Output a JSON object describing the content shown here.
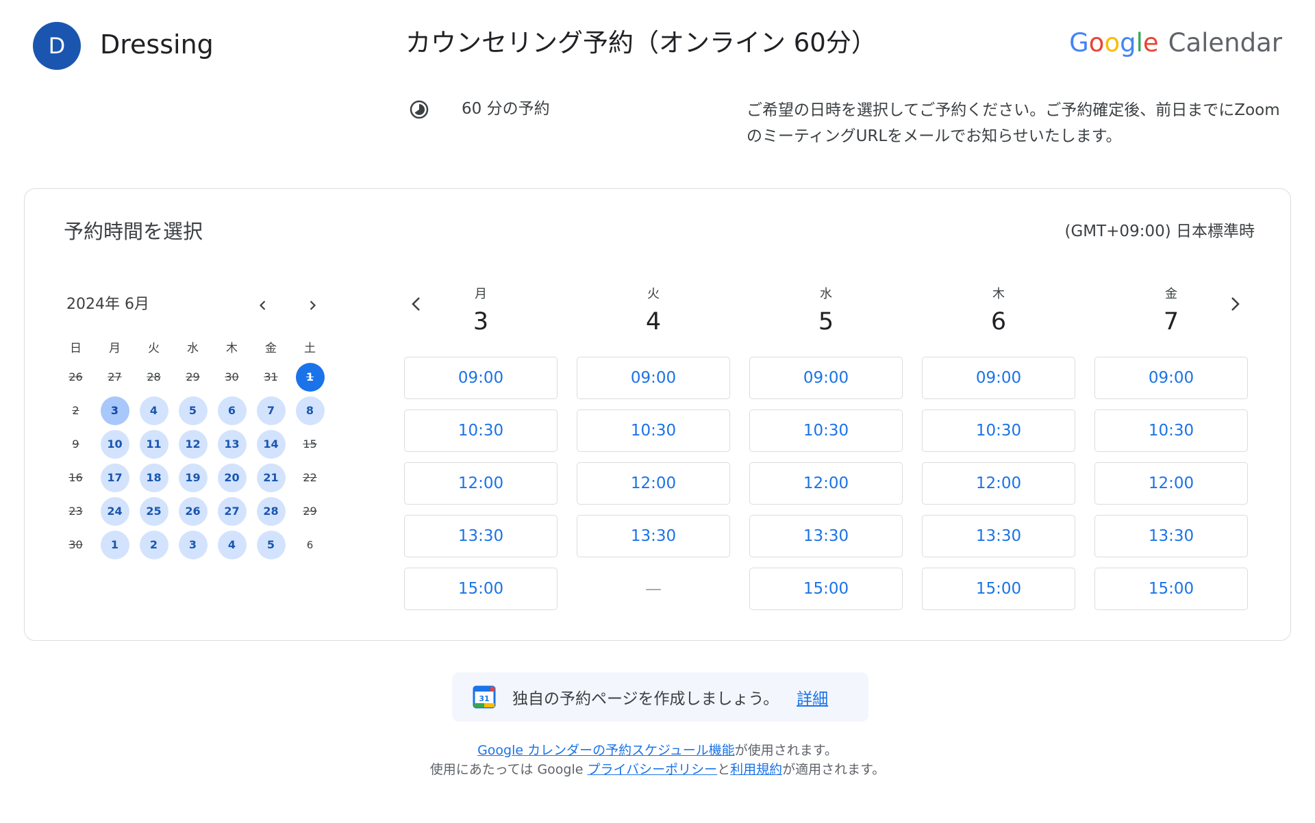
{
  "header": {
    "avatar_letter": "D",
    "org_name": "Dressing",
    "page_title": "カウンセリング予約（オンライン 60分）",
    "logo": {
      "g1": "G",
      "g2": "o",
      "g3": "o",
      "g4": "g",
      "g5": "l",
      "g6": "e",
      "product": "Calendar"
    },
    "duration": "60 分の予約",
    "description": "ご希望の日時を選択してご予約ください。ご予約確定後、前日までにZoomのミーティングURLをメールでお知らせいたします。"
  },
  "card": {
    "title": "予約時間を選択",
    "timezone": "(GMT+09:00) 日本標準時"
  },
  "mini_calendar": {
    "month_label": "2024年 6月",
    "weekdays": [
      "日",
      "月",
      "火",
      "水",
      "木",
      "金",
      "土"
    ],
    "weeks": [
      [
        {
          "d": "26",
          "s": "past"
        },
        {
          "d": "27",
          "s": "past"
        },
        {
          "d": "28",
          "s": "past"
        },
        {
          "d": "29",
          "s": "past"
        },
        {
          "d": "30",
          "s": "past"
        },
        {
          "d": "31",
          "s": "past"
        },
        {
          "d": "1",
          "s": "today"
        }
      ],
      [
        {
          "d": "2",
          "s": "past"
        },
        {
          "d": "3",
          "s": "sel"
        },
        {
          "d": "4",
          "s": "avail"
        },
        {
          "d": "5",
          "s": "avail"
        },
        {
          "d": "6",
          "s": "avail"
        },
        {
          "d": "7",
          "s": "avail"
        },
        {
          "d": "8",
          "s": "avail"
        }
      ],
      [
        {
          "d": "9",
          "s": "past"
        },
        {
          "d": "10",
          "s": "avail"
        },
        {
          "d": "11",
          "s": "avail"
        },
        {
          "d": "12",
          "s": "avail"
        },
        {
          "d": "13",
          "s": "avail"
        },
        {
          "d": "14",
          "s": "avail"
        },
        {
          "d": "15",
          "s": "past"
        }
      ],
      [
        {
          "d": "16",
          "s": "past"
        },
        {
          "d": "17",
          "s": "avail"
        },
        {
          "d": "18",
          "s": "avail"
        },
        {
          "d": "19",
          "s": "avail"
        },
        {
          "d": "20",
          "s": "avail"
        },
        {
          "d": "21",
          "s": "avail"
        },
        {
          "d": "22",
          "s": "past"
        }
      ],
      [
        {
          "d": "23",
          "s": "past"
        },
        {
          "d": "24",
          "s": "avail"
        },
        {
          "d": "25",
          "s": "avail"
        },
        {
          "d": "26",
          "s": "avail"
        },
        {
          "d": "27",
          "s": "avail"
        },
        {
          "d": "28",
          "s": "avail"
        },
        {
          "d": "29",
          "s": "past"
        }
      ],
      [
        {
          "d": "30",
          "s": "past"
        },
        {
          "d": "1",
          "s": "avail"
        },
        {
          "d": "2",
          "s": "avail"
        },
        {
          "d": "3",
          "s": "avail"
        },
        {
          "d": "4",
          "s": "avail"
        },
        {
          "d": "5",
          "s": "avail"
        },
        {
          "d": "6",
          "s": "plain"
        }
      ]
    ]
  },
  "week": {
    "days": [
      {
        "dow": "月",
        "num": "3",
        "slots": [
          "09:00",
          "10:30",
          "12:00",
          "13:30",
          "15:00"
        ]
      },
      {
        "dow": "火",
        "num": "4",
        "slots": [
          "09:00",
          "10:30",
          "12:00",
          "13:30",
          "—"
        ]
      },
      {
        "dow": "水",
        "num": "5",
        "slots": [
          "09:00",
          "10:30",
          "12:00",
          "13:30",
          "15:00"
        ]
      },
      {
        "dow": "木",
        "num": "6",
        "slots": [
          "09:00",
          "10:30",
          "12:00",
          "13:30",
          "15:00"
        ]
      },
      {
        "dow": "金",
        "num": "7",
        "slots": [
          "09:00",
          "10:30",
          "12:00",
          "13:30",
          "15:00"
        ]
      }
    ]
  },
  "promo": {
    "icon_text": "31",
    "text": "独自の予約ページを作成しましょう。",
    "link": "詳細"
  },
  "footer": {
    "line1_link": "Google カレンダーの予約スケジュール機能",
    "line1_rest": "が使用されます。",
    "line2_pre": "使用にあたっては Google ",
    "line2_link1": "プライバシーポリシー",
    "line2_mid": "と",
    "line2_link2": "利用規約",
    "line2_post": "が適用されます。"
  },
  "colors": {
    "accent": "#1a73e8",
    "avatar": "#1a56b0",
    "available": "#d3e3fd",
    "selected": "#a8c7fa"
  }
}
